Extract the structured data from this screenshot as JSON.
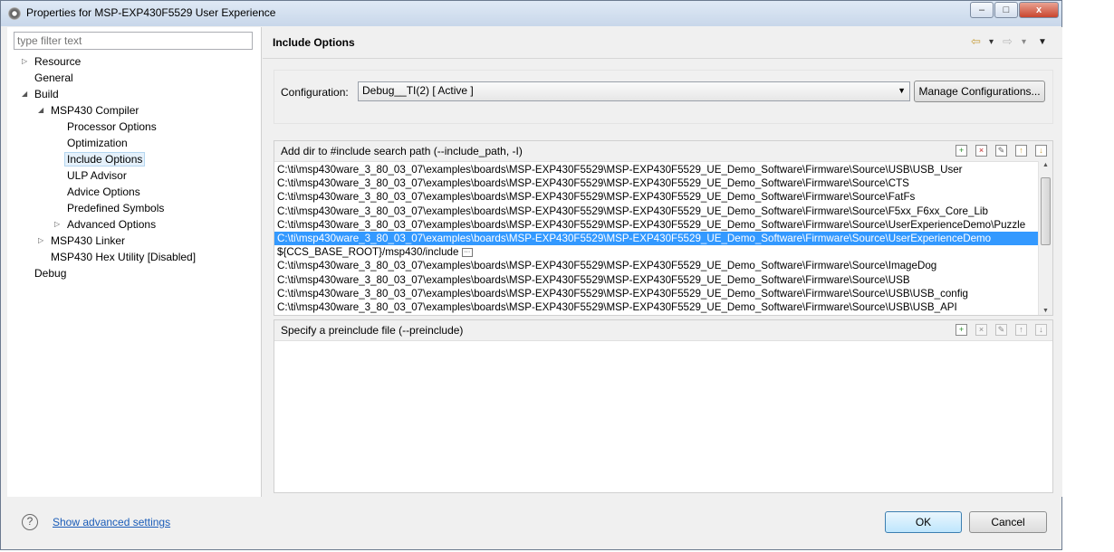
{
  "window": {
    "title": "Properties for MSP-EXP430F5529 User Experience",
    "buttons": {
      "minimize": "–",
      "maximize": "□",
      "close": "x"
    }
  },
  "sidebar": {
    "filter_placeholder": "type filter text",
    "items": [
      {
        "label": "Resource",
        "arrow": "▷"
      },
      {
        "label": "General",
        "arrow": ""
      },
      {
        "label": "Build",
        "arrow": "◢"
      },
      {
        "label": "MSP430 Compiler",
        "arrow": "◢"
      },
      {
        "label": "Processor Options",
        "arrow": ""
      },
      {
        "label": "Optimization",
        "arrow": ""
      },
      {
        "label": "Include Options",
        "arrow": ""
      },
      {
        "label": "ULP Advisor",
        "arrow": ""
      },
      {
        "label": "Advice Options",
        "arrow": ""
      },
      {
        "label": "Predefined Symbols",
        "arrow": ""
      },
      {
        "label": "Advanced Options",
        "arrow": "▷"
      },
      {
        "label": "MSP430 Linker",
        "arrow": "▷"
      },
      {
        "label": "MSP430 Hex Utility  [Disabled]",
        "arrow": ""
      },
      {
        "label": "Debug",
        "arrow": ""
      }
    ]
  },
  "main": {
    "title": "Include Options",
    "nav": {
      "back": "⇦",
      "dropdown": "▾",
      "forward": "⇨",
      "menu": "▼"
    },
    "configuration": {
      "label": "Configuration:",
      "value": "Debug__TI(2)  [ Active ]",
      "dropdown_arrow": "▼",
      "manage_label": "Manage Configurations..."
    },
    "include_paths": {
      "header": "Add dir to #include search path (--include_path, -I)",
      "paths": [
        "C:\\ti\\msp430ware_3_80_03_07\\examples\\boards\\MSP-EXP430F5529\\MSP-EXP430F5529_UE_Demo_Software\\Firmware\\Source\\USB\\USB_User",
        "C:\\ti\\msp430ware_3_80_03_07\\examples\\boards\\MSP-EXP430F5529\\MSP-EXP430F5529_UE_Demo_Software\\Firmware\\Source\\CTS",
        "C:\\ti\\msp430ware_3_80_03_07\\examples\\boards\\MSP-EXP430F5529\\MSP-EXP430F5529_UE_Demo_Software\\Firmware\\Source\\FatFs",
        "C:\\ti\\msp430ware_3_80_03_07\\examples\\boards\\MSP-EXP430F5529\\MSP-EXP430F5529_UE_Demo_Software\\Firmware\\Source\\F5xx_F6xx_Core_Lib",
        "C:\\ti\\msp430ware_3_80_03_07\\examples\\boards\\MSP-EXP430F5529\\MSP-EXP430F5529_UE_Demo_Software\\Firmware\\Source\\UserExperienceDemo\\Puzzle",
        "C:\\ti\\msp430ware_3_80_03_07\\examples\\boards\\MSP-EXP430F5529\\MSP-EXP430F5529_UE_Demo_Software\\Firmware\\Source\\UserExperienceDemo",
        "${CCS_BASE_ROOT}/msp430/include",
        "C:\\ti\\msp430ware_3_80_03_07\\examples\\boards\\MSP-EXP430F5529\\MSP-EXP430F5529_UE_Demo_Software\\Firmware\\Source\\ImageDog",
        "C:\\ti\\msp430ware_3_80_03_07\\examples\\boards\\MSP-EXP430F5529\\MSP-EXP430F5529_UE_Demo_Software\\Firmware\\Source\\USB",
        "C:\\ti\\msp430ware_3_80_03_07\\examples\\boards\\MSP-EXP430F5529\\MSP-EXP430F5529_UE_Demo_Software\\Firmware\\Source\\USB\\USB_config",
        "C:\\ti\\msp430ware_3_80_03_07\\examples\\boards\\MSP-EXP430F5529\\MSP-EXP430F5529_UE_Demo_Software\\Firmware\\Source\\USB\\USB_API"
      ],
      "toolbar_icons": [
        "add-icon",
        "delete-icon",
        "edit-icon",
        "move-up-icon",
        "move-down-icon"
      ]
    },
    "preinclude": {
      "header": "Specify a preinclude file (--preinclude)"
    }
  },
  "footer": {
    "help_icon": "?",
    "advanced_link": "Show advanced settings",
    "ok_label": "OK",
    "cancel_label": "Cancel"
  },
  "colors": {
    "selection": "#3399ff",
    "link": "#1a5cb8",
    "nav_arrow": "#c8a040"
  }
}
